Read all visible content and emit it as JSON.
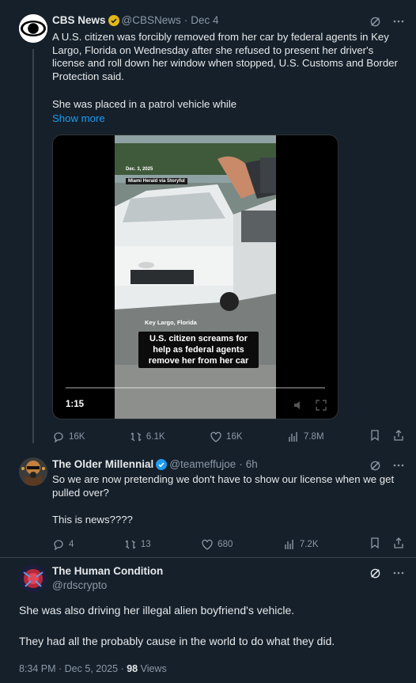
{
  "post1": {
    "author": "CBS News",
    "handle": "@CBSNews",
    "dot": "·",
    "date": "Dec 4",
    "text": "A U.S. citizen was forcibly removed from her car by federal agents in Key Largo, Florida on Wednesday after she refused to present her driver's license and roll down her window when stopped, U.S. Customs and Border Protection said.",
    "text2": "She was placed in a patrol vehicle while",
    "show_more": "Show more",
    "video": {
      "date_tag": "Dec. 3, 2025",
      "source_tag": "Miami Herald via Storyful",
      "location": "Key Largo, Florida",
      "caption": "U.S. citizen screams for help as federal agents remove her from her car",
      "duration": "1:15"
    },
    "stats": {
      "replies": "16K",
      "reposts": "6.1K",
      "likes": "16K",
      "views": "7.8M"
    }
  },
  "post2": {
    "author": "The Older Millennial",
    "handle": "@teameffujoe",
    "dot": "·",
    "date": "6h",
    "text": "So we are now pretending we don't have to show our license when we get pulled over?",
    "text2": "This is news????",
    "stats": {
      "replies": "4",
      "reposts": "13",
      "likes": "680",
      "views": "7.2K"
    }
  },
  "post3": {
    "author": "The Human Condition",
    "handle": "@rdscrypto",
    "text": "She was also driving her illegal alien boyfriend's vehicle.",
    "text2": "They had all the probably cause in the world to do what they did.",
    "timestamp": "8:34 PM · Dec 5, 2025 ·",
    "views_count": "98",
    "views_label": "Views"
  },
  "colors": {
    "background": "#15202b",
    "accent": "#1d9bf0",
    "muted": "#8b98a5",
    "verified_gold": "#e2b719",
    "verified_blue": "#1d9bf0"
  },
  "icons": [
    "grok-icon",
    "more-icon",
    "reply-icon",
    "repost-icon",
    "like-icon",
    "views-icon",
    "bookmark-icon",
    "share-icon"
  ]
}
